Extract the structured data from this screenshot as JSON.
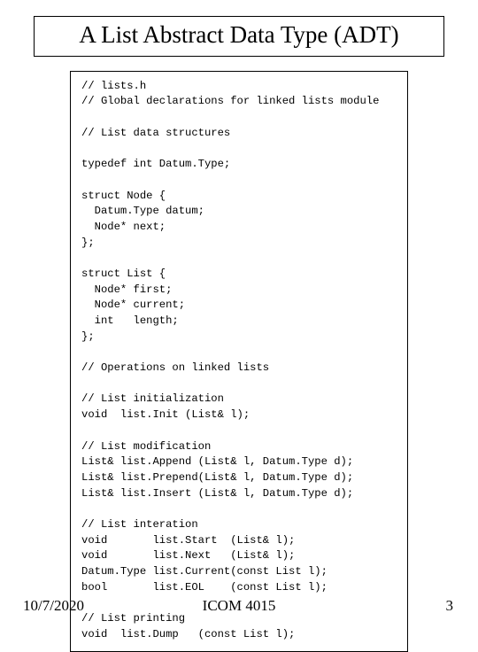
{
  "title": "A List Abstract Data Type (ADT)",
  "code": "// lists.h\n// Global declarations for linked lists module\n\n// List data structures\n\ntypedef int Datum.Type;\n\nstruct Node {\n  Datum.Type datum;\n  Node* next;\n};\n\nstruct List {\n  Node* first;\n  Node* current;\n  int   length;\n};\n\n// Operations on linked lists\n\n// List initialization\nvoid  list.Init (List& l);\n\n// List modification\nList& list.Append (List& l, Datum.Type d);\nList& list.Prepend(List& l, Datum.Type d);\nList& list.Insert (List& l, Datum.Type d);\n\n// List interation\nvoid       list.Start  (List& l);\nvoid       list.Next   (List& l);\nDatum.Type list.Current(const List l);\nbool       list.EOL    (const List l);\n\n// List printing\nvoid  list.Dump   (const List l);",
  "footer": {
    "date": "10/7/2020",
    "course": "ICOM 4015",
    "page": "3"
  }
}
